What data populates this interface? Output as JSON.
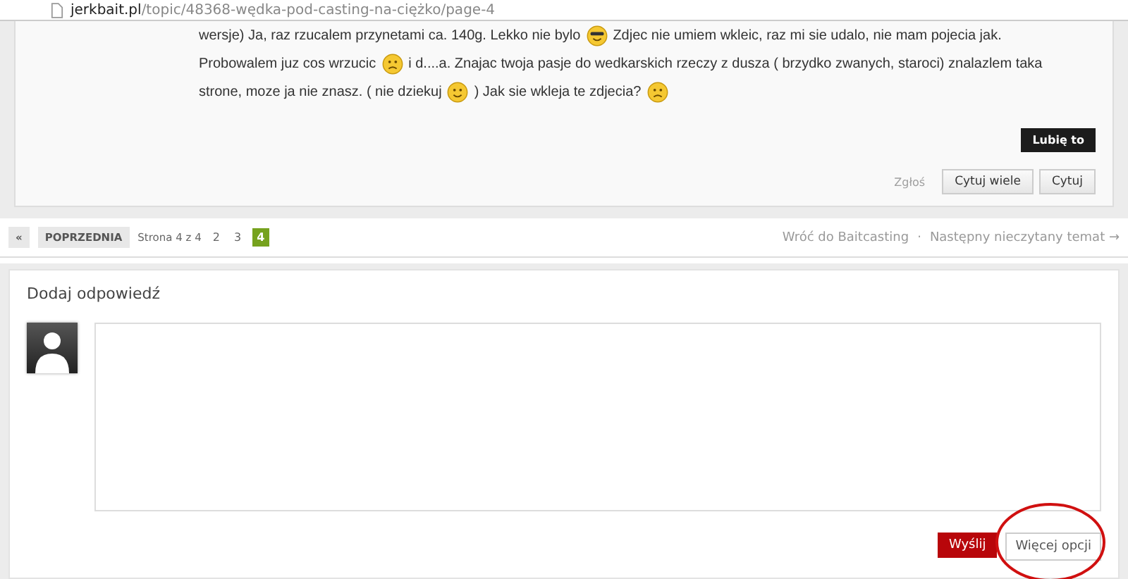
{
  "address_bar": {
    "domain": "jerkbait.pl",
    "path": "/topic/48368-wędka-pod-casting-na-ciężko/page-4"
  },
  "post": {
    "lines": [
      [
        {
          "kind": "text",
          "text": "wersje) Ja, raz rzucalem przynetami ca. 140g. Lekko nie bylo"
        },
        {
          "kind": "cool"
        },
        {
          "kind": "text",
          "text": "Zdjec nie umiem wkleic, raz mi sie udalo, nie mam pojecia jak."
        }
      ],
      [
        {
          "kind": "text",
          "text": "Probowalem juz cos wrzucic"
        },
        {
          "kind": "sad"
        },
        {
          "kind": "text",
          "text": "i d....a. Znajac twoja pasje do wedkarskich rzeczy z dusza (  brzydko zwanych, staroci) znalazlem taka"
        }
      ],
      [
        {
          "kind": "text",
          "text": "strone, moze ja nie znasz. ( nie dziekuj"
        },
        {
          "kind": "smile"
        },
        {
          "kind": "text",
          "text": ") Jak sie wkleja te zdjecia?"
        },
        {
          "kind": "sad"
        }
      ]
    ],
    "like_button": "Lubię to",
    "report_link": "Zgłoś",
    "buttons": [
      "Cytuj wiele",
      "Cytuj"
    ]
  },
  "pagination": {
    "first": "«",
    "prev": "POPRZEDNIA",
    "info": "Strona 4 z 4",
    "pages": [
      {
        "label": "2",
        "selected": false
      },
      {
        "label": "3",
        "selected": false
      },
      {
        "label": "4",
        "selected": true
      }
    ],
    "back_link": "Wróć do Baitcasting",
    "separator": "·",
    "next_link": "Następny nieczytany temat →"
  },
  "reply": {
    "title": "Dodaj odpowiedź",
    "send_button": "Wyślij",
    "more_button": "Więcej opcji",
    "more_highlighted": true
  }
}
